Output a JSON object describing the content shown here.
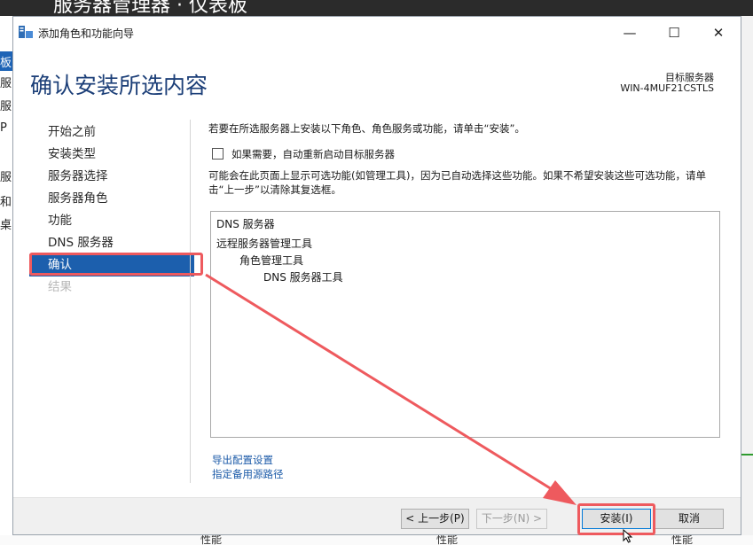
{
  "background": {
    "title": "服务器管理器 · 仪表板",
    "side_glyphs": [
      "板",
      "服",
      "服",
      "P",
      "服",
      "和",
      "桌"
    ],
    "bottom_labels": [
      "性能",
      "性能",
      "性能"
    ]
  },
  "window": {
    "title": "添加角色和功能向导",
    "minimize_glyph": "—",
    "maximize_glyph": "☐",
    "close_glyph": "✕"
  },
  "page": {
    "title": "确认安装所选内容",
    "target_label": "目标服务器",
    "target_name": "WIN-4MUF21CSTLS"
  },
  "nav": {
    "items": [
      {
        "label": "开始之前",
        "state": "normal"
      },
      {
        "label": "安装类型",
        "state": "normal"
      },
      {
        "label": "服务器选择",
        "state": "normal"
      },
      {
        "label": "服务器角色",
        "state": "normal"
      },
      {
        "label": "功能",
        "state": "normal"
      },
      {
        "label": "DNS 服务器",
        "state": "normal"
      },
      {
        "label": "确认",
        "state": "selected"
      },
      {
        "label": "结果",
        "state": "disabled"
      }
    ]
  },
  "content": {
    "instruction": "若要在所选服务器上安装以下角色、角色服务或功能，请单击“安装”。",
    "restart_checkbox": {
      "label": "如果需要，自动重新启动目标服务器",
      "checked": false
    },
    "optional_note": "可能会在此页面上显示可选功能(如管理工具)，因为已自动选择这些功能。如果不希望安装这些可选功能，请单击“上一步”以清除其复选框。",
    "selection_list": [
      {
        "text": "DNS 服务器",
        "level": 0
      },
      {
        "text": "远程服务器管理工具",
        "level": 0
      },
      {
        "text": "角色管理工具",
        "level": 1
      },
      {
        "text": "DNS 服务器工具",
        "level": 2
      }
    ],
    "links": {
      "export": "导出配置设置",
      "alt_source": "指定备用源路径"
    }
  },
  "footer": {
    "prev": "< 上一步(P)",
    "next": "下一步(N) >",
    "install": "安装(I)",
    "cancel": "取消"
  },
  "colors": {
    "accent": "#1c5fad",
    "title": "#1c3f78",
    "annotation": "#ee5a5e",
    "link": "#1b5aa8"
  }
}
